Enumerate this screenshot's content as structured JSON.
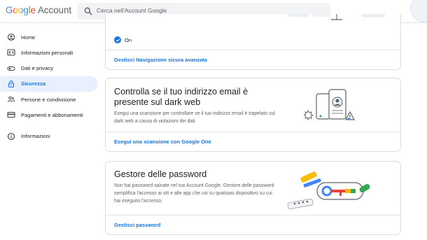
{
  "header": {
    "logo_google": "Google",
    "logo_account": "Account",
    "search_placeholder": "Cerca nell'Account Google"
  },
  "sidebar": {
    "items": [
      {
        "label": "Home",
        "icon": "home-icon"
      },
      {
        "label": "Informazioni personali",
        "icon": "id-card-icon"
      },
      {
        "label": "Dati e privacy",
        "icon": "toggle-icon"
      },
      {
        "label": "Sicurezza",
        "icon": "lock-icon",
        "active": true
      },
      {
        "label": "Persone e condivisione",
        "icon": "people-icon"
      },
      {
        "label": "Pagamenti e abbonamenti",
        "icon": "credit-card-icon"
      },
      {
        "label": "Informazioni",
        "icon": "info-icon"
      }
    ]
  },
  "safe_browsing": {
    "status": "On",
    "link": "Gestisci Navigazione sicura avanzata"
  },
  "dark_web": {
    "title": "Controlla se il tuo indirizzo email è presente sul dark web",
    "description": "Esegui una scansione per controllare se il tuo indirizzo email è trapelato sul dark web a causa di violazioni dei dati",
    "link": "Esegui una scansione con Google One"
  },
  "password_manager": {
    "title": "Gestore delle password",
    "description": "Non hai password salvate nel tuo Account Google. Gestore delle password semplifica l'accesso ai siti e alle app che usi su qualsiasi dispositivo su cui hai eseguito l'accesso.",
    "link": "Gestisci password"
  },
  "colors": {
    "accent": "#1a73e8",
    "active_bg": "#e8f0fe",
    "border": "#dadce0"
  }
}
